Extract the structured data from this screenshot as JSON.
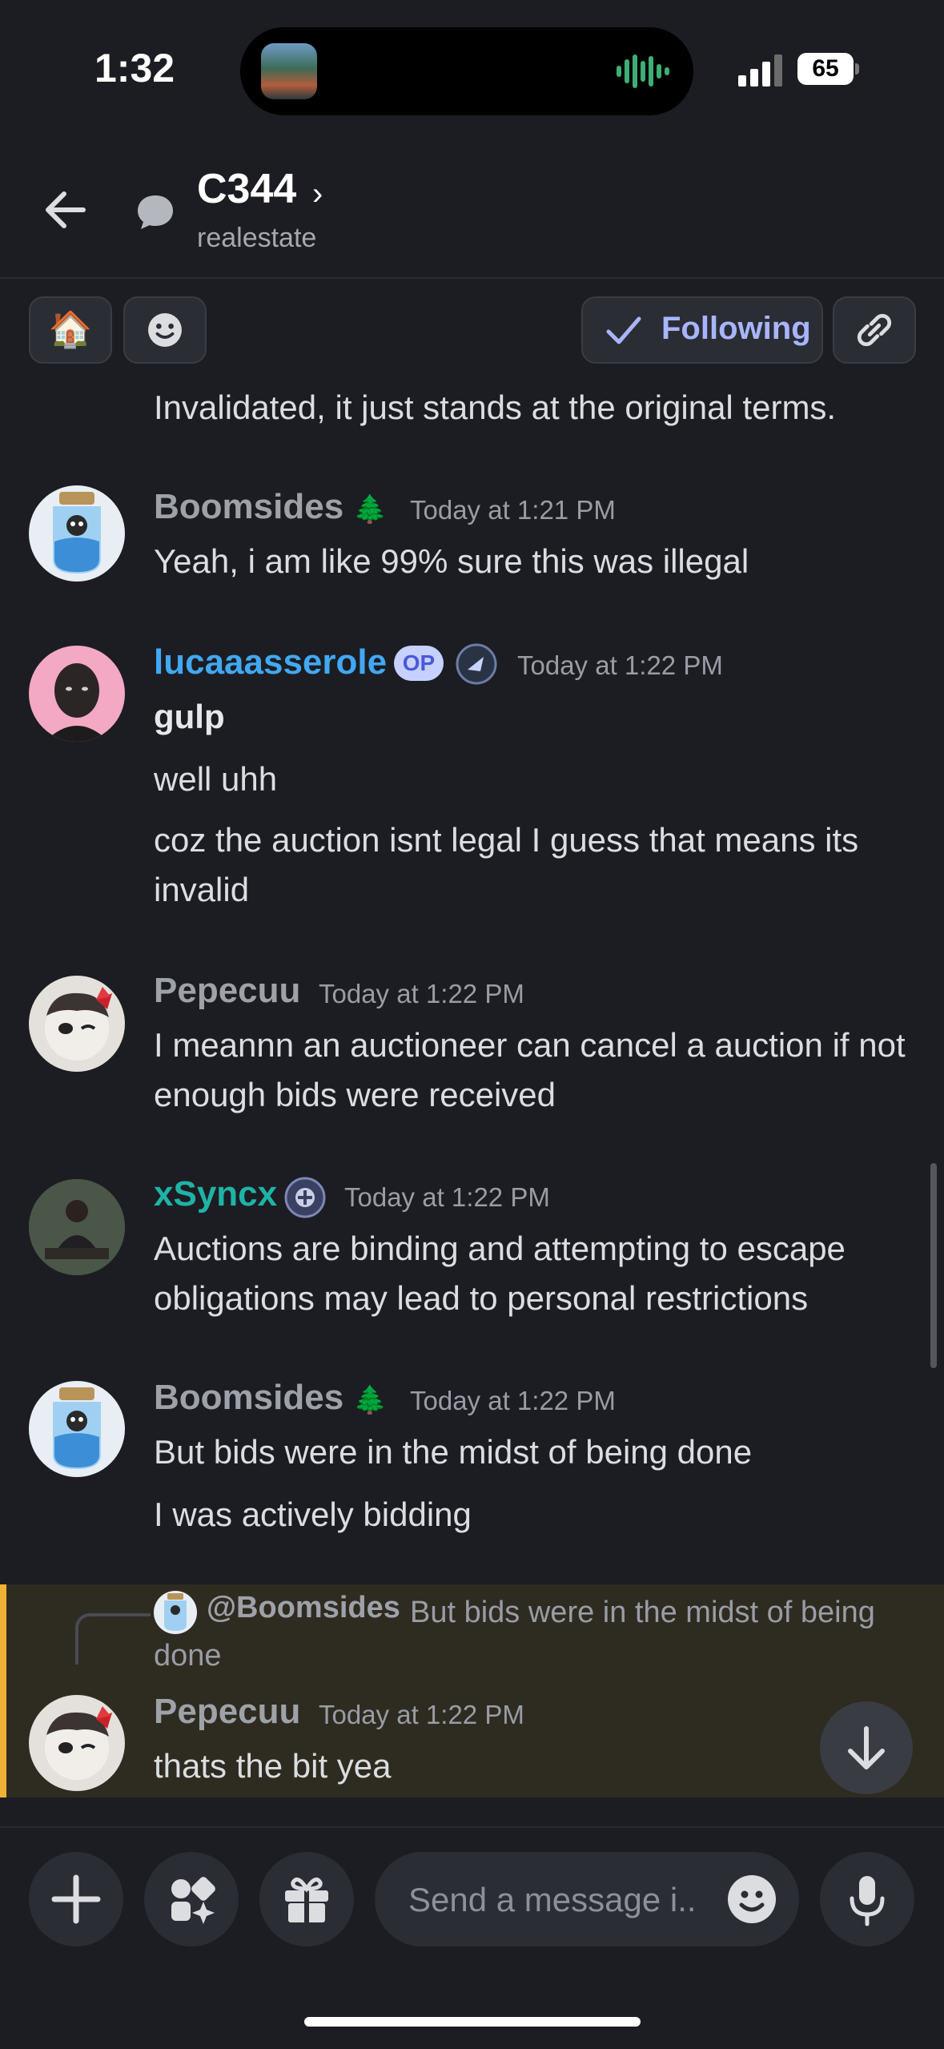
{
  "status_bar": {
    "time": "1:32",
    "battery": "65"
  },
  "header": {
    "title": "C344",
    "subtitle": "realestate"
  },
  "tags": {
    "house_emoji": "🏠",
    "following_label": "Following"
  },
  "colors": {
    "accent": "#a8b5ff",
    "op_user": "#41a8f2",
    "teal_user": "#1fb3a6",
    "default_user": "#9ea2a8",
    "reply_highlight": "#f0b232"
  },
  "messages": [
    {
      "text": "Invalidated, it just stands at the original terms."
    },
    {
      "user": "Boomsides",
      "user_emoji": "🌲",
      "time": "Today at 1:21 PM",
      "lines": [
        "Yeah, i am like 99% sure this was illegal"
      ]
    },
    {
      "user": "lucaaasserole",
      "badge": "OP",
      "time": "Today at 1:22 PM",
      "bold_line": "gulp",
      "lines": [
        "well uhh",
        "coz the auction isnt legal I guess that means its invalid"
      ]
    },
    {
      "user": "Pepecuu",
      "time": "Today at 1:22 PM",
      "lines": [
        "I meannn an auctioneer can cancel a auction if not enough bids were received"
      ]
    },
    {
      "user": "xSyncx",
      "time": "Today at 1:22 PM",
      "lines": [
        "Auctions are binding and attempting to escape obligations may lead to personal restrictions"
      ]
    },
    {
      "user": "Boomsides",
      "user_emoji": "🌲",
      "time": "Today at 1:22 PM",
      "lines": [
        "But bids were in the midst of being done",
        "I was actively bidding"
      ]
    },
    {
      "reply_to_user": "@Boomsides",
      "reply_to_text": "But bids were in the midst of being done",
      "user": "Pepecuu",
      "time": "Today at 1:22 PM",
      "lines": [
        "thats the bit yea"
      ]
    }
  ],
  "composer": {
    "placeholder": "Send a message i.."
  }
}
